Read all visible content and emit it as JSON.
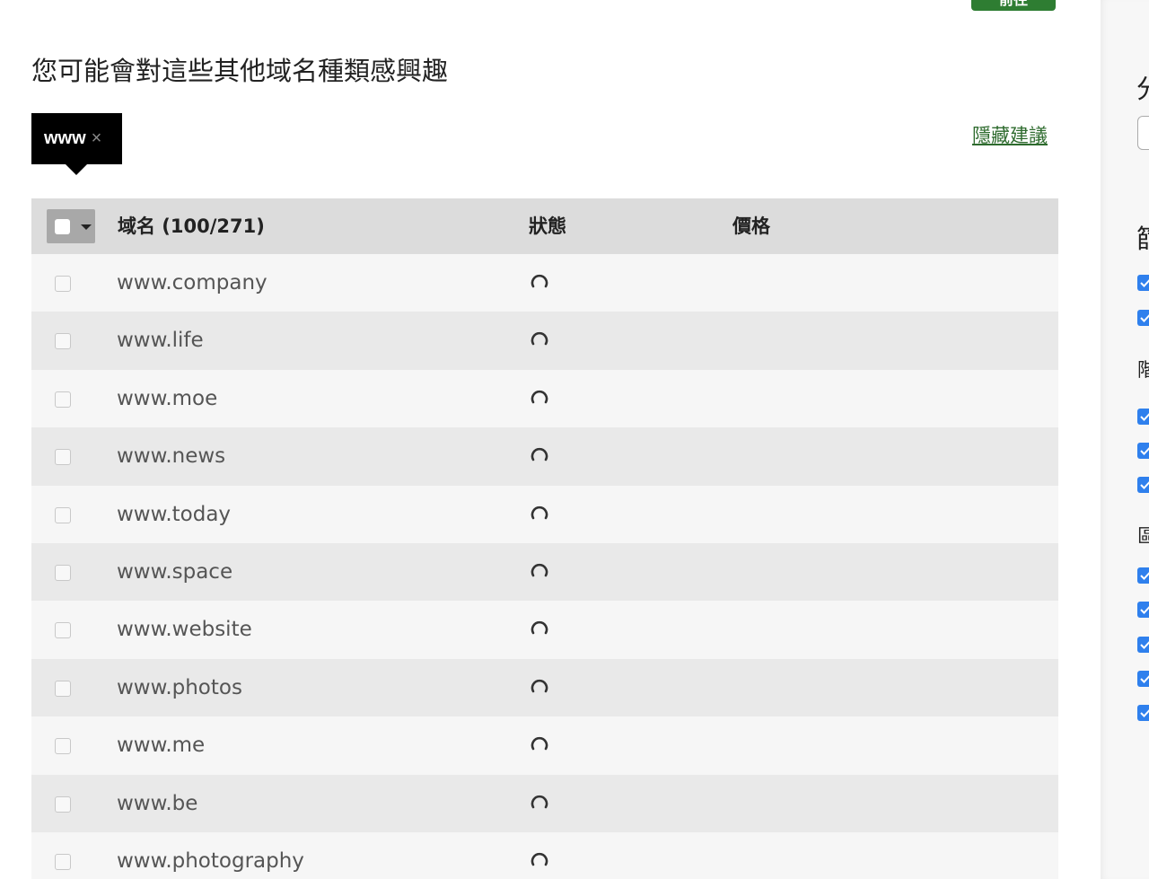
{
  "colors": {
    "accent_green": "#2e7d32",
    "link_green": "#2e6b2e",
    "checkbox_blue": "#2f80ed"
  },
  "top_button": {
    "label": "前往"
  },
  "suggestions": {
    "title": "您可能會對這些其他域名種類感興趣",
    "chip": {
      "label": "www",
      "close_icon": "close-icon",
      "close_glyph": "×"
    },
    "hide_link": "隱藏建議"
  },
  "table": {
    "headers": {
      "domain": "域名 (100/271)",
      "status": "狀態",
      "price": "價格"
    },
    "rows": [
      {
        "domain": "www.company",
        "status_icon": "loading-spinner-icon"
      },
      {
        "domain": "www.life",
        "status_icon": "loading-spinner-icon"
      },
      {
        "domain": "www.moe",
        "status_icon": "loading-spinner-icon"
      },
      {
        "domain": "www.news",
        "status_icon": "loading-spinner-icon"
      },
      {
        "domain": "www.today",
        "status_icon": "loading-spinner-icon"
      },
      {
        "domain": "www.space",
        "status_icon": "loading-spinner-icon"
      },
      {
        "domain": "www.website",
        "status_icon": "loading-spinner-icon"
      },
      {
        "domain": "www.photos",
        "status_icon": "loading-spinner-icon"
      },
      {
        "domain": "www.me",
        "status_icon": "loading-spinner-icon"
      },
      {
        "domain": "www.be",
        "status_icon": "loading-spinner-icon"
      },
      {
        "domain": "www.photography",
        "status_icon": "loading-spinner-icon"
      }
    ]
  },
  "right_panel": {
    "heading_1": "分",
    "heading_2": "篩",
    "group_1": "階",
    "group_2": "區",
    "checked_filters": 10
  }
}
